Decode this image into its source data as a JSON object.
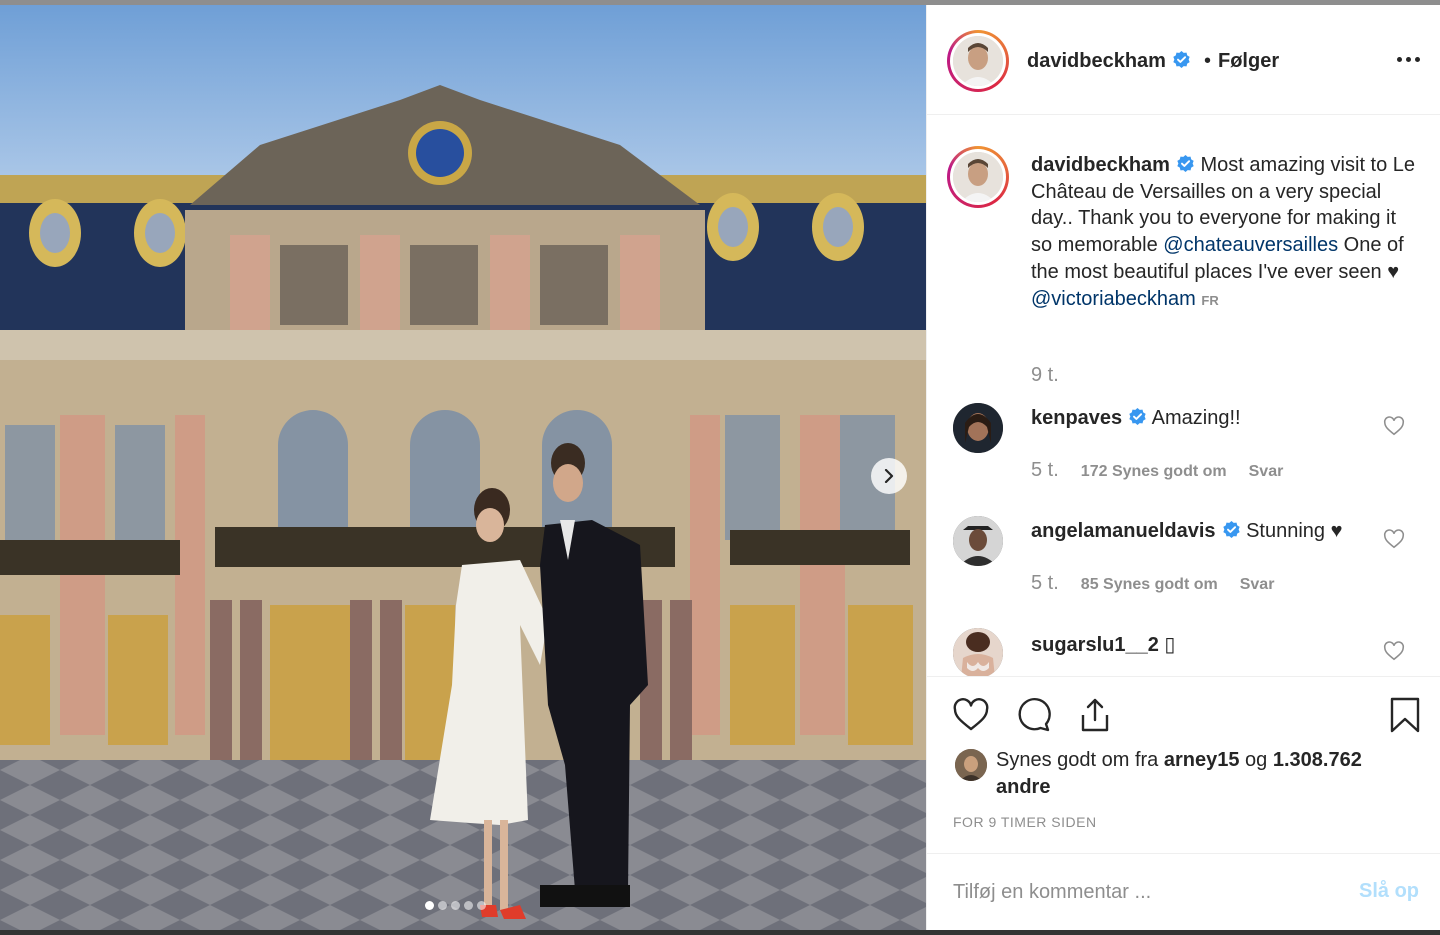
{
  "post": {
    "username": "davidbeckham",
    "separator": "•",
    "follow_status": "Følger",
    "more_label": "…",
    "image_alt": "Couple standing in front of Le Château de Versailles"
  },
  "caption": {
    "username": "davidbeckham",
    "text_1": " Most amazing visit to Le Château de Versailles on a very special day.. Thank you to everyone for making it so memorable ",
    "mention_1": "@chateauversailles",
    "text_2": " One of the most beautiful places I've ever seen ♥ ",
    "mention_2": "@victoriabeckham",
    "lang": "FR",
    "time": "9 t."
  },
  "comments": [
    {
      "username": "kenpaves",
      "text": "Amazing!!",
      "time": "5 t.",
      "likes": "172 Synes godt om",
      "reply": "Svar"
    },
    {
      "username": "angelamanueldavis",
      "text": "Stunning ♥",
      "time": "5 t.",
      "likes": "85 Synes godt om",
      "reply": "Svar"
    },
    {
      "username": "sugarslu1__2",
      "text": "▯"
    }
  ],
  "likes": {
    "prefix": "Synes godt om fra ",
    "user": "arney15",
    "mid": " og ",
    "count": "1.308.762 andre"
  },
  "time_ago": "FOR 9 TIMER SIDEN",
  "comment_box": {
    "placeholder": "Tilføj en kommentar ...",
    "post_label": "Slå op"
  },
  "carousel": {
    "count": 5,
    "active_index": 0
  },
  "colors": {
    "verified": "#3897f0",
    "link": "#003569",
    "muted": "#8e8e8e",
    "post_disabled": "#b2dffc"
  }
}
